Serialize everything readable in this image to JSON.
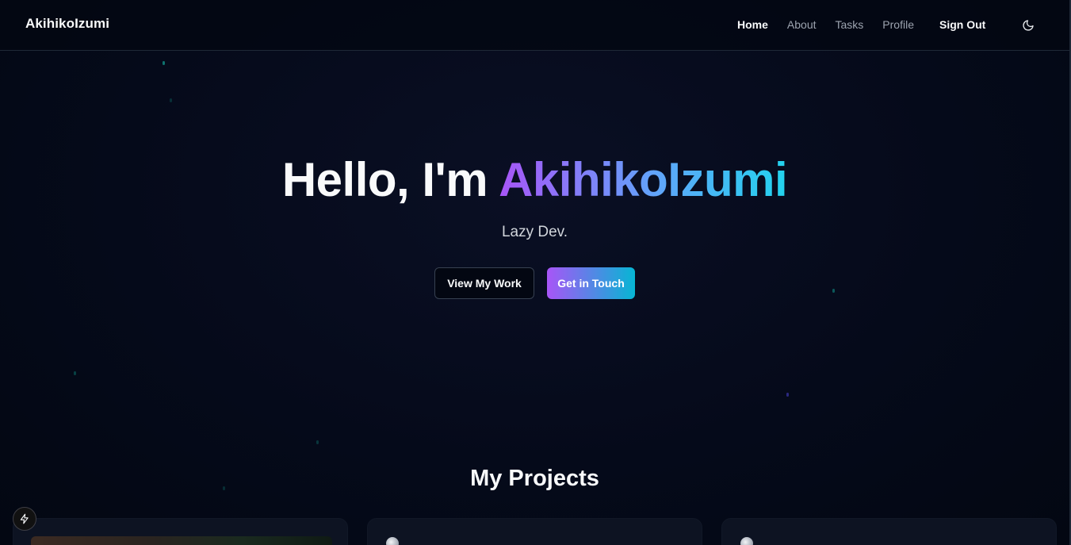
{
  "nav": {
    "brand": "AkihikoIzumi",
    "links": [
      {
        "label": "Home",
        "active": true
      },
      {
        "label": "About",
        "active": false
      },
      {
        "label": "Tasks",
        "active": false
      },
      {
        "label": "Profile",
        "active": false
      }
    ],
    "sign_out": "Sign Out",
    "theme_icon": "moon-icon"
  },
  "hero": {
    "greeting": "Hello, I'm ",
    "name": "AkihikoIzumi",
    "tagline": "Lazy Dev.",
    "primary_button": "View My Work",
    "secondary_button": "Get in Touch"
  },
  "projects": {
    "title": "My Projects",
    "cards": [
      {
        "has_image": true,
        "icon": "",
        "title": ""
      },
      {
        "has_image": false,
        "icon": "globe-icon",
        "title": ""
      },
      {
        "has_image": false,
        "icon": "globe-icon",
        "title": ""
      }
    ]
  },
  "colors": {
    "background": "#030712",
    "accent_start": "#a855f7",
    "accent_end": "#06b6d4",
    "card_bg": "#0d1322"
  },
  "dev_badge_icon": "lightning-icon"
}
